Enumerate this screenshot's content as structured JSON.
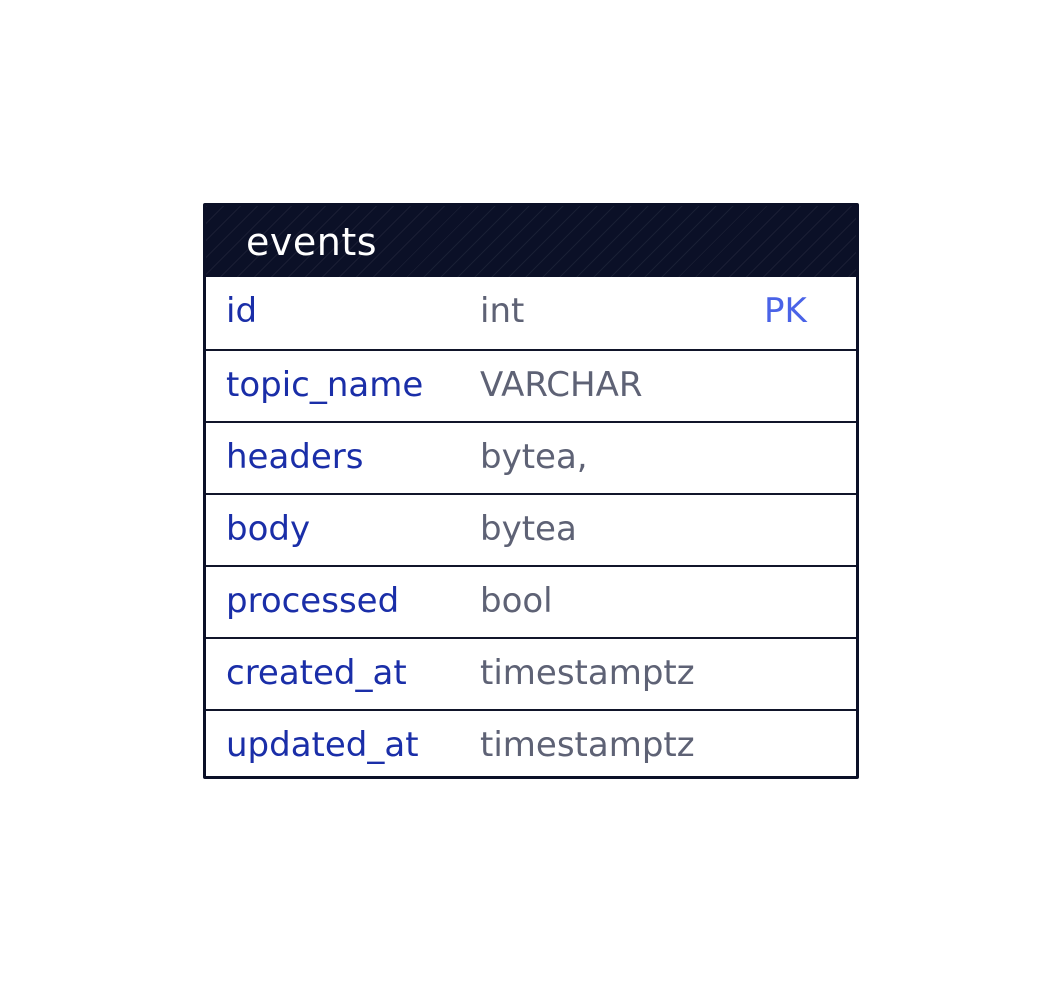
{
  "table": {
    "title": "events",
    "columns": [
      {
        "name": "id",
        "type": "int",
        "key": "PK"
      },
      {
        "name": "topic_name",
        "type": "VARCHAR",
        "key": ""
      },
      {
        "name": "headers",
        "type": "bytea,",
        "key": ""
      },
      {
        "name": "body",
        "type": "bytea",
        "key": ""
      },
      {
        "name": "processed",
        "type": "bool",
        "key": ""
      },
      {
        "name": "created_at",
        "type": "timestamptz",
        "key": ""
      },
      {
        "name": "updated_at",
        "type": "timestamptz",
        "key": ""
      }
    ]
  },
  "colors": {
    "header_bg": "#0b1027",
    "header_text": "#ffffff",
    "column_name": "#1a2ea8",
    "column_type": "#5e6275",
    "key_badge": "#4a63e7",
    "border": "#0b1027"
  }
}
